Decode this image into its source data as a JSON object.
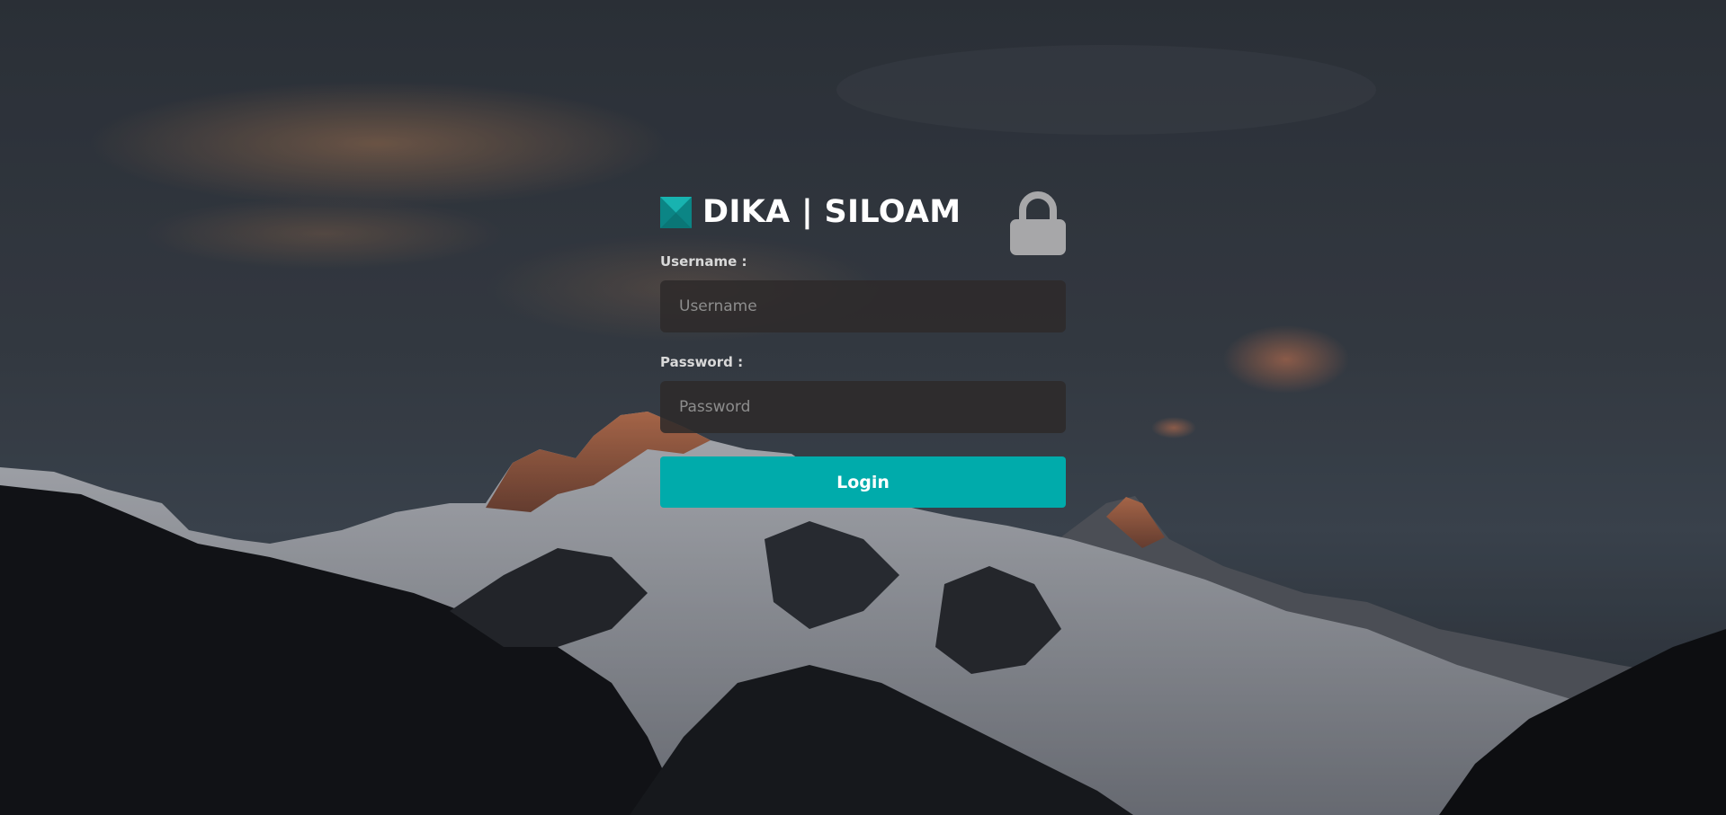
{
  "brand": {
    "title": "DIKA | SILOAM",
    "logo_icon": "siloam-x-logo-icon",
    "logo_color": "#0d9e9e"
  },
  "form": {
    "lock_icon": "lock-icon",
    "username_label": "Username :",
    "username_placeholder": "Username",
    "username_value": "",
    "password_label": "Password :",
    "password_placeholder": "Password",
    "password_value": "",
    "login_label": "Login"
  },
  "colors": {
    "accent": "#00abab",
    "input_bg": "#2d2a2a",
    "label": "#d9d9d9"
  },
  "background": {
    "icon": "mountain-sunset-background"
  }
}
